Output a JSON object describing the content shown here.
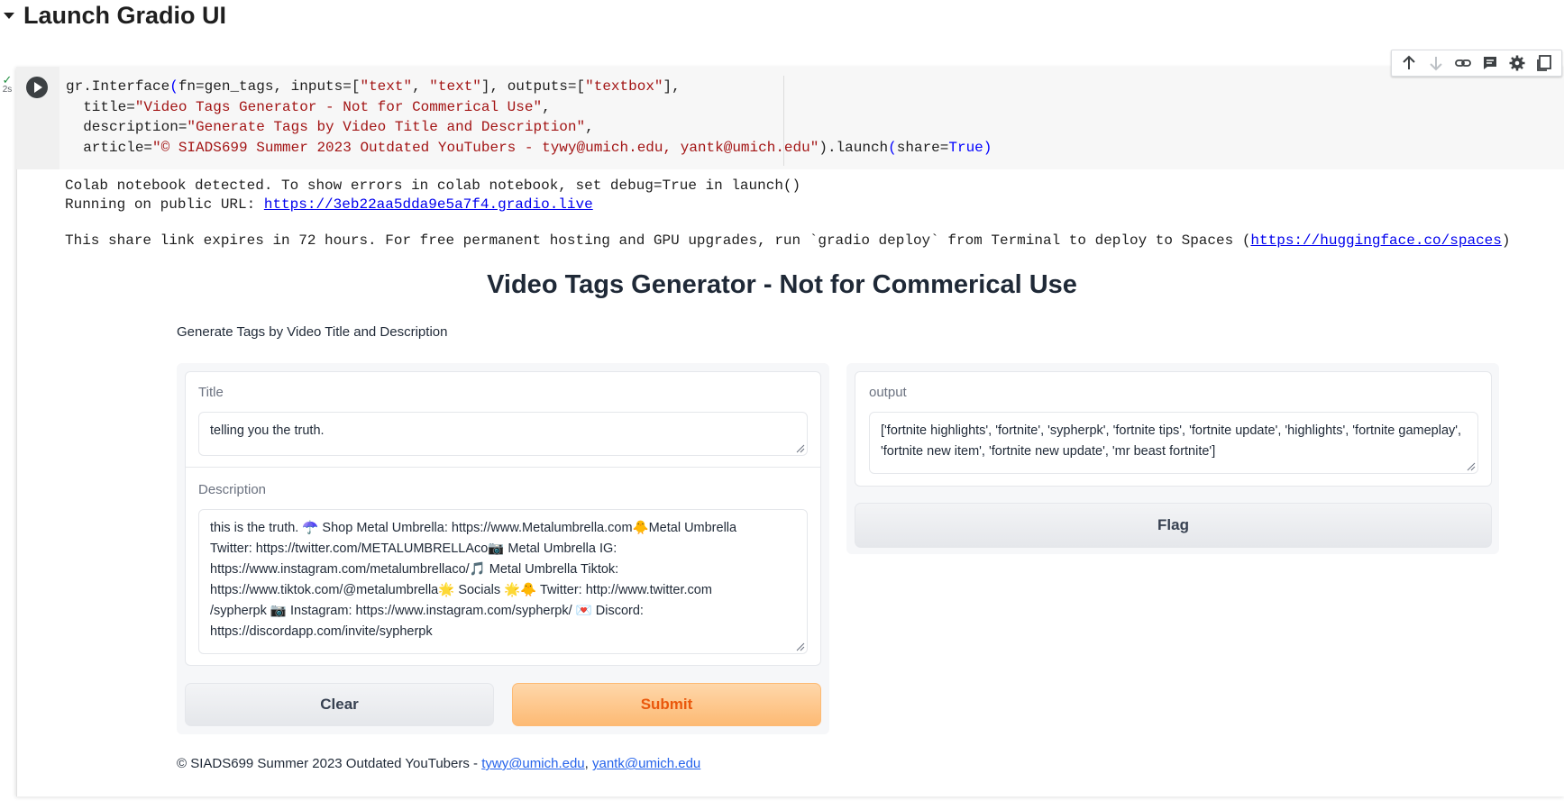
{
  "section": {
    "title": "Launch Gradio UI"
  },
  "cell": {
    "exec_time": "2s",
    "code_lines": [
      [
        [
          "gr.Interface",
          ""
        ],
        [
          "(",
          "blue"
        ],
        [
          "fn=gen_tags, inputs=[",
          ""
        ],
        [
          "\"text\"",
          "str"
        ],
        [
          ", ",
          ""
        ],
        [
          "\"text\"",
          "str"
        ],
        [
          "], outputs=[",
          ""
        ],
        [
          "\"textbox\"",
          "str"
        ],
        [
          "],",
          ""
        ]
      ],
      [
        [
          "  title=",
          ""
        ],
        [
          "\"Video Tags Generator - Not for Commerical Use\"",
          "str"
        ],
        [
          ",",
          ""
        ]
      ],
      [
        [
          "  description=",
          ""
        ],
        [
          "\"Generate Tags by Video Title and Description\"",
          "str"
        ],
        [
          ",",
          ""
        ]
      ],
      [
        [
          "  article=",
          ""
        ],
        [
          "\"© SIADS699 Summer 2023 Outdated YouTubers - tywy@umich.edu, yantk@umich.edu\"",
          "str"
        ],
        [
          ").launch",
          ""
        ],
        [
          "(",
          "blue"
        ],
        [
          "share=",
          ""
        ],
        [
          "True",
          "blue"
        ],
        [
          ")",
          "blue"
        ]
      ]
    ]
  },
  "output": {
    "line1": "Colab notebook detected. To show errors in colab notebook, set debug=True in launch()",
    "line2_prefix": "Running on public URL: ",
    "public_url": "https://3eb22aa5dda9e5a7f4.gradio.live",
    "line3_prefix": "This share link expires in 72 hours. For free permanent hosting and GPU upgrades, run `gradio deploy` from Terminal to deploy to Spaces (",
    "spaces_url": "https://huggingface.co/spaces",
    "line3_suffix": ")"
  },
  "gradio": {
    "title": "Video Tags Generator - Not for Commerical Use",
    "description": "Generate Tags by Video Title and Description",
    "title_label": "Title",
    "title_value": "telling you the truth.",
    "description_label": "Description",
    "description_lines": [
      "this is the truth. ☂️ Shop Metal Umbrella: https://www.Metalumbrella.com🐥Metal Umbrella",
      "Twitter: https://twitter.com/METALUMBRELLAco📷 Metal Umbrella IG:",
      "https://www.instagram.com/metalumbrellaco/🎵 Metal Umbrella Tiktok:",
      "https://www.tiktok.com/@metalumbrella🌟 Socials 🌟🐥 Twitter: http://www.twitter.com",
      "/sypherpk 📷 Instagram: https://www.instagram.com/sypherpk/ 💌 Discord:",
      "https://discordapp.com/invite/sypherpk"
    ],
    "output_label": "output",
    "output_value": "['fortnite highlights', 'fortnite', 'sypherpk', 'fortnite tips', 'fortnite update', 'highlights', 'fortnite gameplay', 'fortnite new item', 'fortnite new update', 'mr beast fortnite']",
    "clear_label": "Clear",
    "submit_label": "Submit",
    "flag_label": "Flag",
    "article_prefix": "© SIADS699 Summer 2023 Outdated YouTubers - ",
    "email1": "tywy@umich.edu",
    "article_sep": ", ",
    "email2": "yantk@umich.edu"
  },
  "toolbar_icons": [
    "arrow-up-icon",
    "arrow-down-icon",
    "link-icon",
    "comment-icon",
    "gear-icon",
    "mirror-cell-icon"
  ],
  "colors": {
    "accent": "#ea580c",
    "primary_bg": "#fdba74",
    "link": "#2563eb",
    "string": "#a31515",
    "keyword": "#0000ff"
  }
}
